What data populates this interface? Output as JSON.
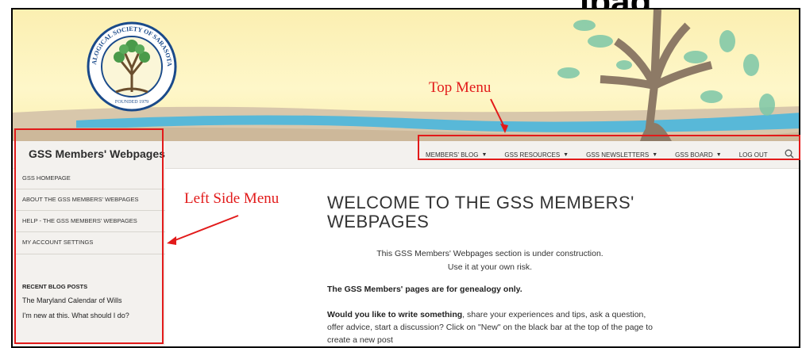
{
  "top_heading": "ipag",
  "site": {
    "title": "GSS Members' Webpages"
  },
  "nav": {
    "items": [
      "MEMBERS' BLOG",
      "GSS RESOURCES",
      "GSS NEWSLETTERS",
      "GSS BOARD",
      "LOG OUT"
    ],
    "dropdown_flags": [
      true,
      true,
      true,
      true,
      false
    ],
    "search_icon": "search-icon"
  },
  "sidebar": {
    "links": [
      "GSS HOMEPAGE",
      "ABOUT THE GSS MEMBERS' WEBPAGES",
      "HELP - THE GSS MEMBERS' WEBPAGES",
      "MY ACCOUNT SETTINGS"
    ],
    "recent_title": "RECENT BLOG POSTS",
    "recent_posts": [
      "The Maryland Calendar of Wills",
      "I'm new at this. What should I do?"
    ]
  },
  "main": {
    "title": "WELCOME TO THE GSS MEMBERS' WEBPAGES",
    "notice_line1": "This GSS Members' Webpages section is under construction.",
    "notice_line2": "Use it at your own risk.",
    "para1": "The GSS Members' pages are for genealogy only.",
    "para2_bold": "Would you like to write something",
    "para2_rest": ", share your experiences and tips, ask a question, offer advice, start a discussion? Click on \"New\" on the black bar at the top of the page to create a new post"
  },
  "annotations": {
    "top_menu": "Top Menu",
    "left_menu": "Left Side Menu"
  },
  "logo": {
    "text": "GENEALOGICAL SOCIETY OF SARASOTA, INC.",
    "founded": "FOUNDED 1979"
  },
  "colors": {
    "annotation": "#e21a1a",
    "sidebar_bg": "#f3f1ee",
    "banner": "#fdf3b9"
  }
}
